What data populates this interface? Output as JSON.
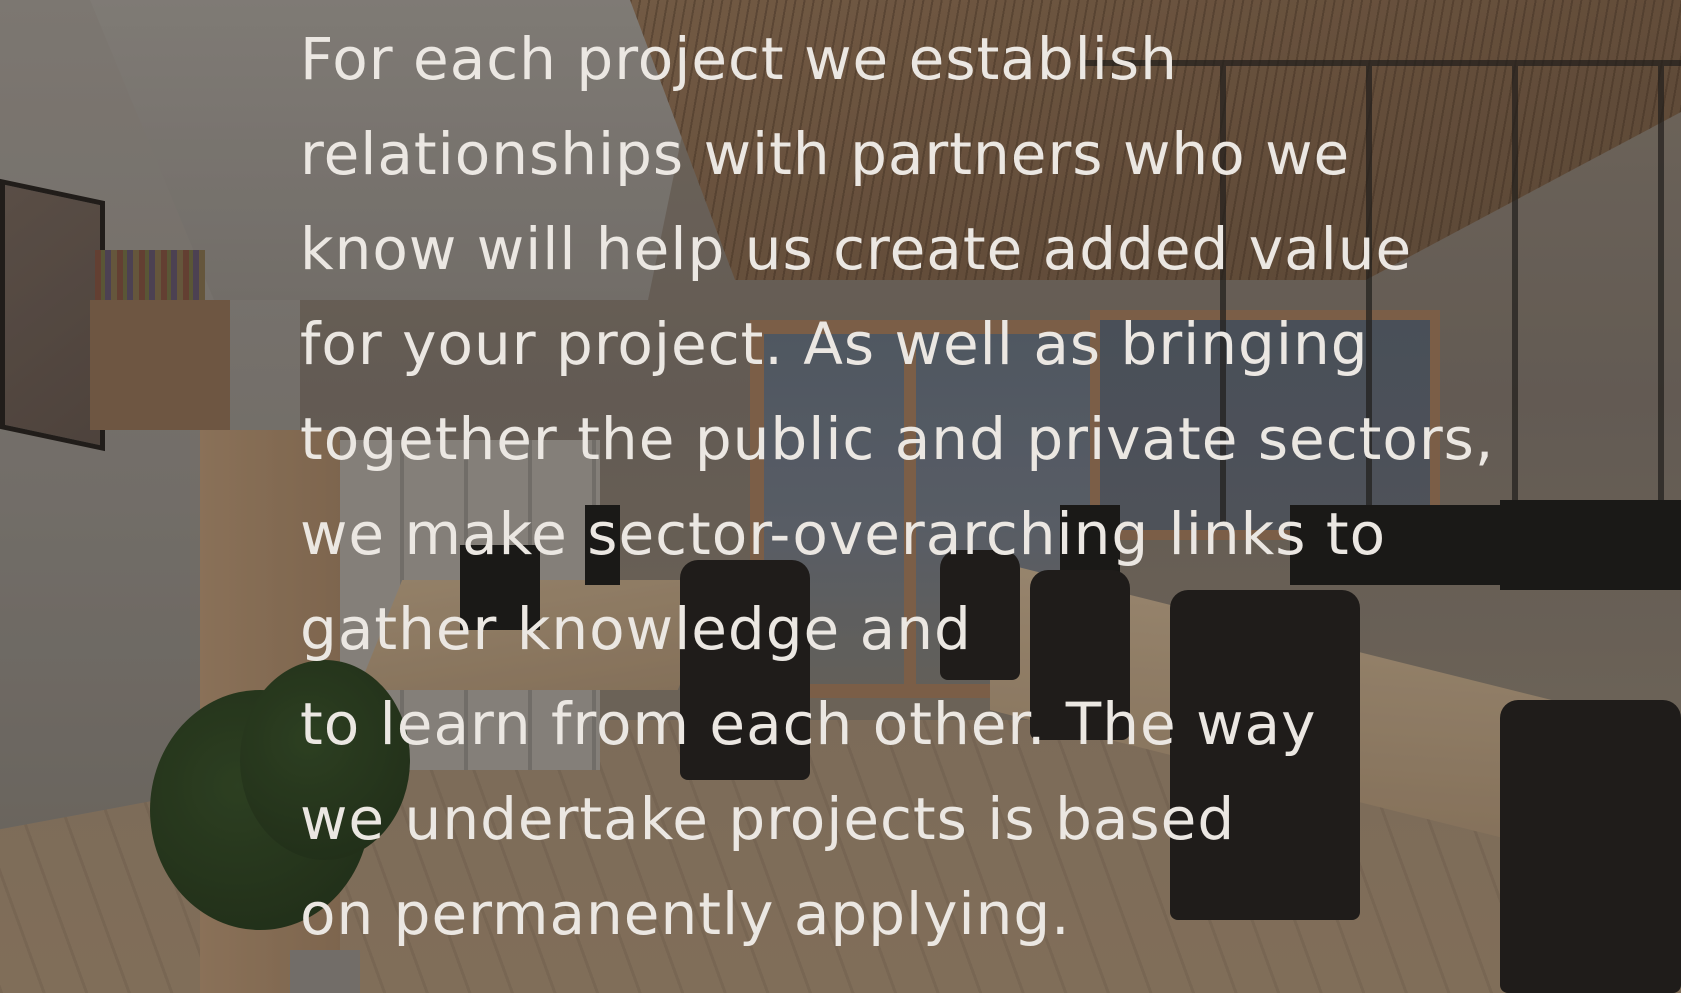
{
  "background": {
    "image": "office-interior-photo",
    "overlay_color": "#28241f"
  },
  "text": {
    "lines": [
      "For each project we establish",
      "relationships with partners who we",
      "know will help us create added value",
      "for your project. As well as bringing",
      "together the public and private sectors,",
      "we make sector-overarching links to",
      "gather knowledge and",
      "to learn from each other. The way",
      "we undertake projects is based",
      "on permanently applying."
    ],
    "color": "#ebe7e2"
  }
}
